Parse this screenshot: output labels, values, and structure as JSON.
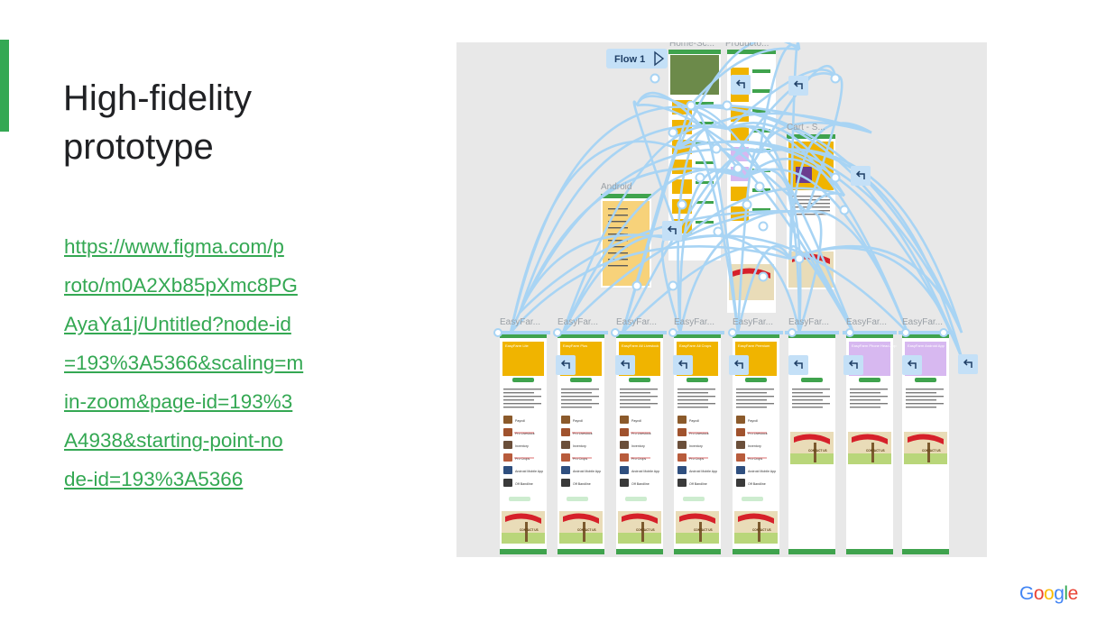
{
  "slide": {
    "title_lines": [
      "High-fidelity",
      "prototype"
    ],
    "link_lines": [
      "https://www.figma.com/p",
      "roto/m0A2Xb85pXmc8PG",
      "AyaYa1j/Untitled?node-id",
      "=193%3A5366&scaling=m",
      "in-zoom&page-id=193%3",
      "A4938&starting-point-no",
      "de-id=193%3A5366"
    ],
    "link_color": "#34a853",
    "accent_color": "#34a853"
  },
  "prototype": {
    "flow_label": "Flow 1",
    "play_icon": "play-triangle-icon",
    "back_icon": "back-arrow-icon",
    "frame_labels": {
      "home": "Home-Sc...",
      "product": "Producto...",
      "cart": "Cart - S...",
      "android": "Android"
    },
    "bottom_frame_labels": [
      "EasyFar...",
      "EasyFar...",
      "EasyFar...",
      "EasyFar...",
      "EasyFar...",
      "EasyFar...",
      "EasyFar...",
      "EasyFar..."
    ],
    "product_titles": [
      "EasyFarm Lite",
      "EasyFarm Plus",
      "EasyFarm All Livestock",
      "EasyFarm All Crops",
      "EasyFarm Premium",
      "",
      "EasyFarm Phone Head App",
      "EasyFarm Android App"
    ],
    "feature_rows": [
      "Payroll",
      "Pro Livestock",
      "Inventory",
      "Pro Crops",
      "Android Mobile App",
      "Off Bandline"
    ],
    "contact_label": "CONTACT US"
  },
  "footer": {
    "brand_letters": [
      "G",
      "o",
      "o",
      "g",
      "l",
      "e"
    ],
    "brand_colors": [
      "#4285f4",
      "#ea4335",
      "#fbbc05",
      "#4285f4",
      "#34a853",
      "#ea4335"
    ]
  }
}
